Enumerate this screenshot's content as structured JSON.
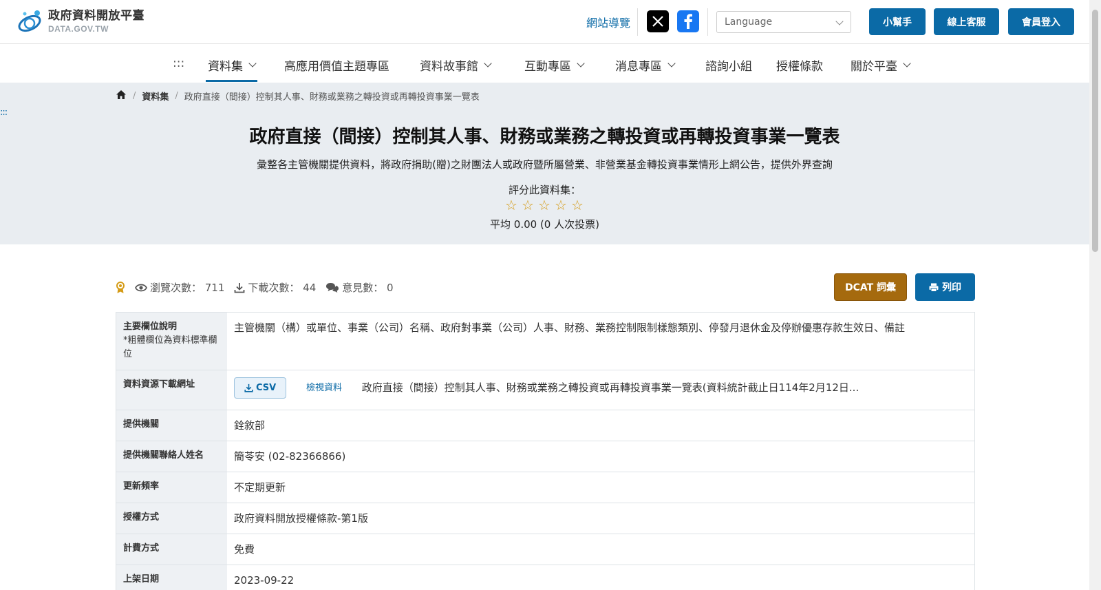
{
  "logo": {
    "name_cn": "政府資料開放平臺",
    "name_en": "DATA.GOV.TW"
  },
  "header": {
    "site_nav": "網站導覽",
    "language_placeholder": "Language",
    "help_label": "小幫手",
    "service_label": "線上客服",
    "login_label": "會員登入"
  },
  "nav": {
    "menu_toggle": ":::",
    "items": [
      {
        "label": "資料集"
      },
      {
        "label": "高應用價值主題專區"
      },
      {
        "label": "資料故事館"
      },
      {
        "label": "互動專區"
      },
      {
        "label": "消息專區"
      },
      {
        "label": "諮詢小組"
      },
      {
        "label": "授權條款"
      },
      {
        "label": "關於平臺"
      }
    ]
  },
  "breadcrumb": {
    "items": [
      {
        "label": "資料集"
      },
      {
        "label": "政府直接（間接）控制其人事、財務或業務之轉投資或再轉投資事業一覽表"
      }
    ]
  },
  "skip_anchor": ":::",
  "hero": {
    "title": "政府直接（間接）控制其人事、財務或業務之轉投資或再轉投資事業一覽表",
    "description": "彙整各主管機關提供資料，將政府捐助(贈)之財團法人或政府暨所屬營業、非營業基金轉投資事業情形上網公告，提供外界查詢",
    "rate_label": "評分此資料集：",
    "rating_value": 0,
    "rating_max": 5,
    "rating_avg": "平均 0.00 (0 人次投票)"
  },
  "stats": {
    "views": "瀏覽次數： 711",
    "downloads": "下載次數： 44",
    "comments": "意見數： 0"
  },
  "actions": {
    "dcat_label": "DCAT 詞彙",
    "print_label": "列印"
  },
  "info": {
    "fields_label": "主要欄位說明",
    "fields_note": "*粗體欄位為資料標準欄位",
    "fields_value": "主管機關（構）或單位、事業（公司）名稱、政府對事業（公司）人事、財務、業務控制限制樣態類別、停發月退休金及停辦優惠存款生效日、備註",
    "resource_label": "資料資源下載網址",
    "csv_label": "CSV",
    "view_label": "檢視資料",
    "resource_desc": "政府直接（間接）控制其人事、財務或業務之轉投資或再轉投資事業一覽表(資料統計截止日114年2月12日...",
    "provider_label": "提供機關",
    "provider_value": "銓敘部",
    "contact_label": "提供機關聯絡人姓名",
    "contact_value": "簡苓安 (02-82366866)",
    "frequency_label": "更新頻率",
    "frequency_value": "不定期更新",
    "license_label": "授權方式",
    "license_value": "政府資料開放授權條款-第1版",
    "fee_label": "計費方式",
    "fee_value": "免費",
    "date_label": "上架日期",
    "date_value": "2023-09-22"
  },
  "colors": {
    "primary": "#0b6aa6",
    "dcat": "#a56a0e",
    "hero_bg": "#e9edf1",
    "star": "#d59b16"
  }
}
